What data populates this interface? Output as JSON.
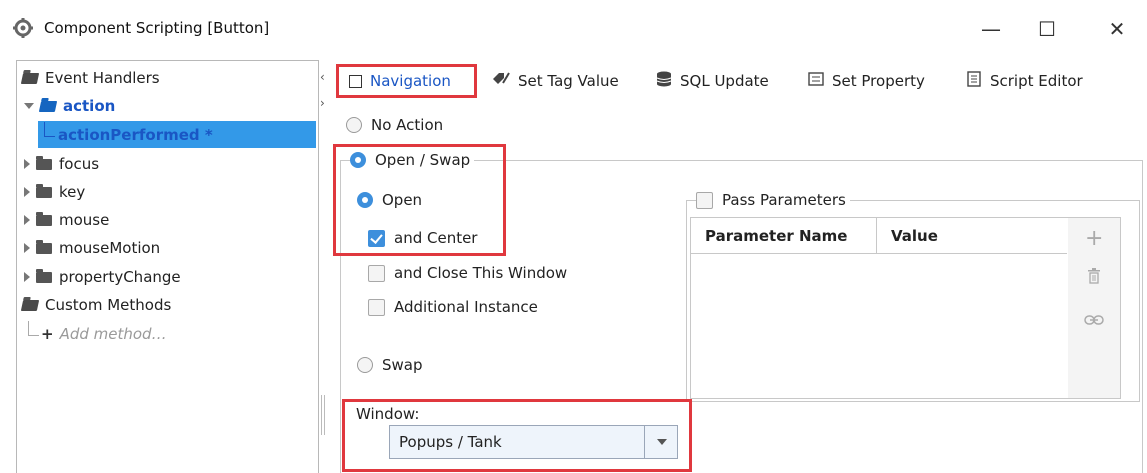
{
  "window": {
    "title": "Component Scripting [Button]",
    "minimize": "—",
    "maximize": "☐",
    "close": "✕"
  },
  "tree": {
    "event_handlers": "Event Handlers",
    "action": "action",
    "action_performed": "actionPerformed *",
    "focus": "focus",
    "key": "key",
    "mouse": "mouse",
    "mouse_motion": "mouseMotion",
    "property_change": "propertyChange",
    "custom_methods": "Custom Methods",
    "add_method": "Add method…"
  },
  "tabs": {
    "navigation": "Navigation",
    "set_tag_value": "Set Tag Value",
    "sql_update": "SQL Update",
    "set_property": "Set Property",
    "script_editor": "Script Editor"
  },
  "options": {
    "no_action": "No Action",
    "open_swap": "Open / Swap",
    "open": "Open",
    "and_center": "and Center",
    "and_close": "and Close This Window",
    "additional_instance": "Additional Instance",
    "swap": "Swap",
    "pass_parameters": "Pass Parameters"
  },
  "state": {
    "open_swap_selected": true,
    "open_selected": true,
    "and_center_checked": true,
    "and_close_checked": false,
    "additional_instance_checked": false,
    "pass_parameters_checked": false
  },
  "params_table": {
    "columns": [
      "Parameter Name",
      "Value"
    ],
    "rows": []
  },
  "window_field": {
    "label": "Window:",
    "value": "Popups / Tank"
  },
  "colors": {
    "highlight_red": "#e0383e",
    "selection_blue": "#3399e8",
    "link_blue": "#1a56c4",
    "radio_blue": "#3d8fdc"
  }
}
